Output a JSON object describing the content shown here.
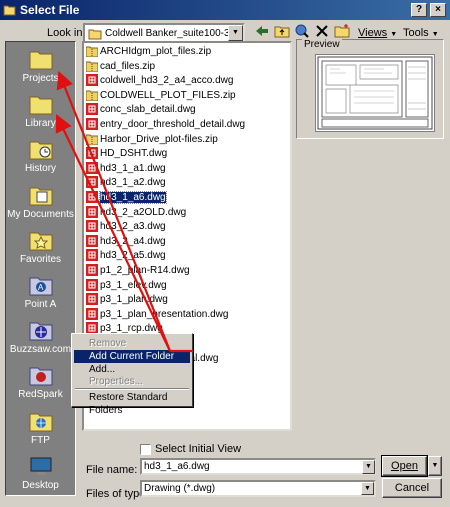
{
  "window": {
    "title": "Select File",
    "help_glyph": "?",
    "close_glyph": "×"
  },
  "toolbar": {
    "look_in_label": "Look in:",
    "look_in_value": "Coldwell Banker_suite100-3h1",
    "views_label": "Views",
    "tools_label": "Tools"
  },
  "places": [
    {
      "label": "Projects",
      "icon": "folder-icon"
    },
    {
      "label": "Library",
      "icon": "folder-icon"
    },
    {
      "label": "History",
      "icon": "history-folder-icon"
    },
    {
      "label": "My Documents",
      "icon": "documents-folder-icon"
    },
    {
      "label": "Favorites",
      "icon": "favorites-folder-icon"
    },
    {
      "label": "Point A",
      "icon": "point-a-icon"
    },
    {
      "label": "Buzzsaw.com",
      "icon": "buzzsaw-icon"
    },
    {
      "label": "RedSpark",
      "icon": "redspark-icon"
    },
    {
      "label": "FTP",
      "icon": "ftp-icon"
    },
    {
      "label": "Desktop",
      "icon": "desktop-icon"
    }
  ],
  "files": [
    {
      "name": "ARCHIdgm_plot_files.zip",
      "type": "zip"
    },
    {
      "name": "cad_files.zip",
      "type": "zip"
    },
    {
      "name": "coldwell_hd3_2_a4_acco.dwg",
      "type": "dwg"
    },
    {
      "name": "COLDWELL_PLOT_FILES.zip",
      "type": "zip"
    },
    {
      "name": "conc_slab_detail.dwg",
      "type": "dwg"
    },
    {
      "name": "entry_door_threshold_detail.dwg",
      "type": "dwg"
    },
    {
      "name": "Harbor_Drive_plot-files.zip",
      "type": "zip"
    },
    {
      "name": "HD_DSHT.dwg",
      "type": "dwg"
    },
    {
      "name": "hd3_1_a1.dwg",
      "type": "dwg"
    },
    {
      "name": "hd3_1_a2.dwg",
      "type": "dwg"
    },
    {
      "name": "hd3_1_a6.dwg",
      "type": "dwg",
      "selected": true
    },
    {
      "name": "hd3_2_a2OLD.dwg",
      "type": "dwg"
    },
    {
      "name": "hd3_2_a3.dwg",
      "type": "dwg"
    },
    {
      "name": "hd3_2_a4.dwg",
      "type": "dwg"
    },
    {
      "name": "hd3_2_a5.dwg",
      "type": "dwg"
    },
    {
      "name": "p1_2_plan-R14.dwg",
      "type": "dwg"
    },
    {
      "name": "p3_1_elev.dwg",
      "type": "dwg"
    },
    {
      "name": "p3_1_plan.dwg",
      "type": "dwg"
    },
    {
      "name": "p3_1_plan_presentation.dwg",
      "type": "dwg"
    },
    {
      "name": "p3_1_rcp.dwg",
      "type": "dwg"
    },
    {
      "name": "proposedPlan.dwg",
      "type": "dwg"
    },
    {
      "name": "proposedPlan-original.dwg",
      "type": "dwg"
    }
  ],
  "preview": {
    "label": "Preview"
  },
  "context_menu": {
    "items": [
      {
        "label": "Remove",
        "disabled": true
      },
      {
        "label": "Add Current Folder",
        "highlighted": true
      },
      {
        "label": "Add..."
      },
      {
        "label": "Properties...",
        "disabled": true
      },
      {
        "label": "Restore Standard Folders"
      }
    ]
  },
  "options": {
    "select_initial_view_label": "Select Initial View"
  },
  "file_name": {
    "label": "File name:",
    "value": "hd3_1_a6.dwg"
  },
  "file_type": {
    "label": "Files of type:",
    "value": "Drawing (*.dwg)"
  },
  "buttons": {
    "open": "Open",
    "cancel": "Cancel"
  },
  "colors": {
    "title_bar": "#0a246a",
    "selection": "#0a246a",
    "annotation_arrow": "#e01010",
    "dialog_bg": "#d4d0c8"
  }
}
